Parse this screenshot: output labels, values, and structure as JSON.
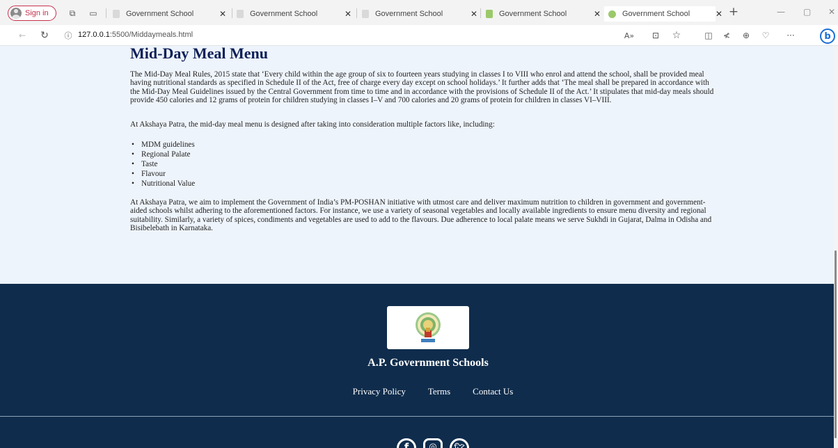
{
  "browser": {
    "sign_in": "Sign in",
    "tabs": [
      {
        "label": "Government School"
      },
      {
        "label": "Government School"
      },
      {
        "label": "Government School"
      },
      {
        "label": "Government School"
      },
      {
        "label": "Government School"
      }
    ],
    "new_tab": "+",
    "url_host": "127.0.0.1",
    "url_path": ":5500/Middaymeals.html",
    "more": "···"
  },
  "page": {
    "heading": "Mid-Day Meal Menu",
    "para1": "The Mid-Day Meal Rules, 2015 state that ‘Every child within the age group of six to fourteen years studying in classes I to VIII who enrol and attend the school, shall be provided meal having nutritional standards as specified in Schedule II of the Act, free of charge every day except on school holidays.’ It further adds that ‘The meal shall be prepared in accordance with the Mid-Day Meal Guidelines issued by the Central Government from time to time and in accordance with the provisions of Schedule II of the Act.’ It stipulates that mid-day meals should provide 450 calories and 12 grams of protein for children studying in classes I–V and 700 calories and 20 grams of protein for children in classes VI–VIII.",
    "para2": "At Akshaya Patra, the mid-day meal menu is designed after taking into consideration multiple factors like, including:",
    "factors": [
      "MDM guidelines",
      "Regional Palate",
      "Taste",
      "Flavour",
      "Nutritional Value"
    ],
    "para3": "At Akshaya Patra, we aim to implement the Government of India’s PM-POSHAN initiative with utmost care and deliver maximum nutrition to children in government and government-aided schools whilst adhering to the aforementioned factors. For instance, we use a variety of seasonal vegetables and locally available ingredients to ensure menu diversity and regional suitability. Similarly, a variety of spices, condiments and vegetables are used to add to the flavours. Due adherence to local palate means we serve Sukhdi in Gujarat, Dalma in Odisha and Bisibelebath in Karnataka."
  },
  "footer": {
    "brand": "A.P. Government Schools",
    "links": [
      "Privacy Policy",
      "Terms",
      "Contact Us"
    ]
  },
  "colors": {
    "page_bg": "#eef4fb",
    "footer_bg": "#0f2c4c",
    "heading": "#0e1f57",
    "signin_accent": "#c4314b"
  }
}
